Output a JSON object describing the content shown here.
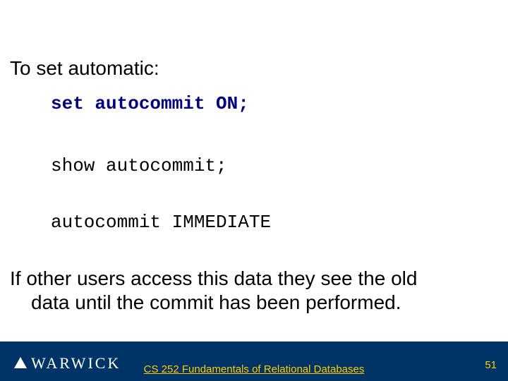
{
  "heading": "To set automatic:",
  "code_lines": {
    "set_cmd": "set autocommit ON;",
    "show_cmd": "show autocommit;",
    "result": "autocommit IMMEDIATE"
  },
  "paragraph": {
    "line1": "If other users access this data they see the old",
    "line2": "data until the commit has been performed."
  },
  "footer": {
    "logo_text": "WARWICK",
    "course": "CS 252 Fundamentals of Relational Databases",
    "page": "51"
  },
  "chart_data": null
}
